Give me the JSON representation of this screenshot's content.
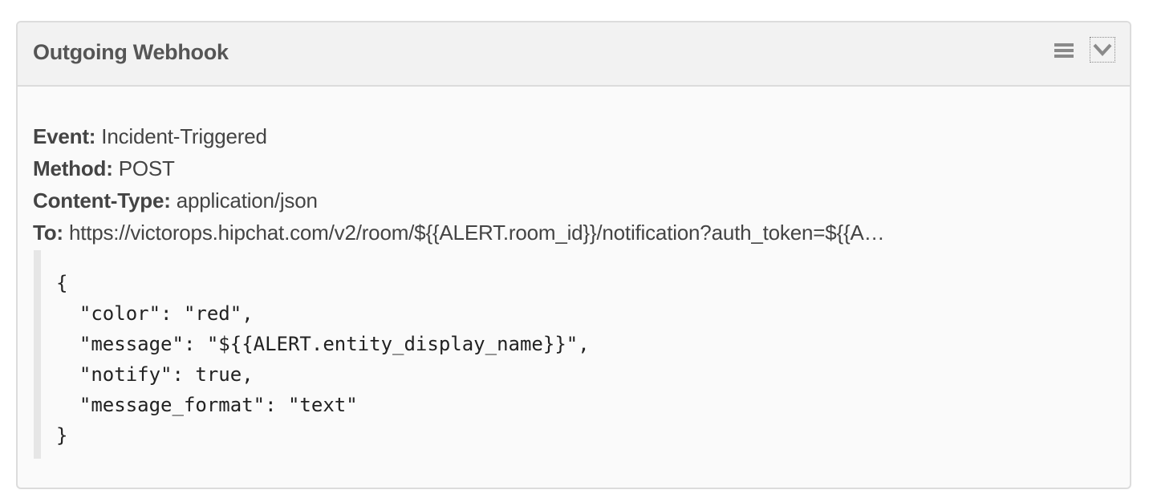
{
  "panel": {
    "title": "Outgoing Webhook",
    "menu_icon": "hamburger-menu-icon",
    "collapse_icon": "chevron-down-icon"
  },
  "fields": [
    {
      "key": "Event:",
      "value": "Incident-Triggered"
    },
    {
      "key": "Method:",
      "value": "POST"
    },
    {
      "key": "Content-Type:",
      "value": "application/json"
    },
    {
      "key": "To:",
      "value": "https://victorops.hipchat.com/v2/room/${{ALERT.room_id}}/notification?auth_token=${{A…"
    }
  ],
  "payload_lines": [
    "{",
    "  \"color\": \"red\",",
    "  \"message\": \"${{ALERT.entity_display_name}}\",",
    "  \"notify\": true,",
    "  \"message_format\": \"text\"",
    "}"
  ],
  "colors": {
    "header_bg": "#f2f2f2",
    "body_bg": "#fafafa",
    "border": "#dcdcdc",
    "text": "#444444"
  }
}
